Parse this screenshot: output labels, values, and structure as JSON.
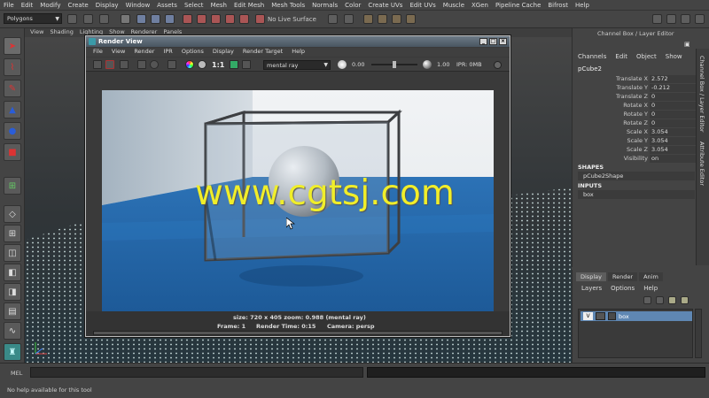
{
  "menu": [
    "File",
    "Edit",
    "Modify",
    "Create",
    "Display",
    "Window",
    "Assets",
    "Select",
    "Mesh",
    "Edit Mesh",
    "Mesh Tools",
    "Normals",
    "Color",
    "Create UVs",
    "Edit UVs",
    "Muscle",
    "XGen",
    "Pipeline Cache",
    "Bifrost",
    "Help"
  ],
  "shelf": {
    "mode": "Polygons",
    "live_surface": "No Live Surface"
  },
  "viewport_menu": [
    "View",
    "Shading",
    "Lighting",
    "Show",
    "Renderer",
    "Panels"
  ],
  "render_view": {
    "title": "Render View",
    "menu": [
      "File",
      "View",
      "Render",
      "IPR",
      "Options",
      "Display",
      "Render Target",
      "Help"
    ],
    "one_to_one": "1:1",
    "renderer": "mental ray",
    "exposure": "0.00",
    "gamma": "1.00",
    "ipr_mem": "IPR: 0MB",
    "footer_line1": "size: 720 x 405 zoom: 0.988       (mental ray)",
    "footer_frame": "Frame: 1",
    "footer_time": "Render Time: 0:15",
    "footer_camera": "Camera: persp"
  },
  "channel_box": {
    "title": "Channel Box / Layer Editor",
    "tabs": [
      "Channels",
      "Edit",
      "Object",
      "Show"
    ],
    "object": "pCube2",
    "attributes": [
      {
        "name": "Translate X",
        "value": "2.572"
      },
      {
        "name": "Translate Y",
        "value": "-0.212"
      },
      {
        "name": "Translate Z",
        "value": "0"
      },
      {
        "name": "Rotate X",
        "value": "0"
      },
      {
        "name": "Rotate Y",
        "value": "0"
      },
      {
        "name": "Rotate Z",
        "value": "0"
      },
      {
        "name": "Scale X",
        "value": "3.054"
      },
      {
        "name": "Scale Y",
        "value": "3.054"
      },
      {
        "name": "Scale Z",
        "value": "3.054"
      },
      {
        "name": "Visibility",
        "value": "on"
      }
    ],
    "shapes_header": "SHAPES",
    "shape_name": "pCube2Shape",
    "inputs_header": "INPUTS",
    "input_name": "box"
  },
  "side_tabs": [
    "Channel Box / Layer Editor",
    "Attribute Editor"
  ],
  "layer_editor": {
    "tabs": [
      "Display",
      "Render",
      "Anim"
    ],
    "menu": [
      "Layers",
      "Options",
      "Help"
    ],
    "layer_visible": "V",
    "layer_name": "box"
  },
  "command_line": {
    "label": "MEL",
    "help": "No help available for this tool"
  },
  "watermark": "www.cgtsj.com"
}
